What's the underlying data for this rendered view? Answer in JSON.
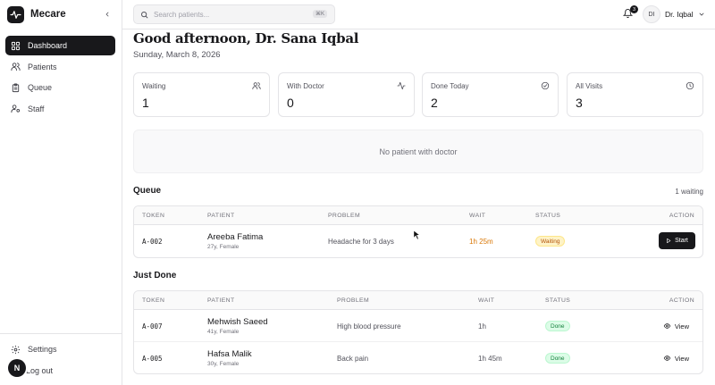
{
  "app": {
    "name": "Mecare"
  },
  "sidebar": {
    "items": [
      {
        "label": "Dashboard",
        "icon": "grid-icon",
        "active": true
      },
      {
        "label": "Patients",
        "icon": "users-icon"
      },
      {
        "label": "Queue",
        "icon": "clipboard-icon"
      },
      {
        "label": "Staff",
        "icon": "user-cog-icon"
      }
    ],
    "settings_label": "Settings",
    "logout_label": "Log out",
    "badge_letter": "N"
  },
  "topbar": {
    "search_placeholder": "Search patients...",
    "search_shortcut": "⌘K",
    "notification_count": "3",
    "user_initials": "DI",
    "user_name": "Dr. Iqbal"
  },
  "greeting": "Good afternoon, Dr. Sana Iqbal",
  "date": "Sunday, March 8, 2026",
  "stats": [
    {
      "label": "Waiting",
      "value": "1",
      "icon": "users-icon"
    },
    {
      "label": "With Doctor",
      "value": "0",
      "icon": "activity-icon"
    },
    {
      "label": "Done Today",
      "value": "2",
      "icon": "check-circle-icon"
    },
    {
      "label": "All Visits",
      "value": "3",
      "icon": "clock-icon"
    }
  ],
  "empty_with_doctor": "No patient with doctor",
  "queue": {
    "title": "Queue",
    "meta": "1 waiting",
    "columns": [
      "TOKEN",
      "PATIENT",
      "PROBLEM",
      "WAIT",
      "STATUS",
      "ACTION"
    ],
    "rows": [
      {
        "token": "A-002",
        "name": "Areeba Fatima",
        "meta": "27y, Female",
        "problem": "Headache for 3 days",
        "wait": "1h 25m",
        "status": "Waiting",
        "action": "Start"
      }
    ]
  },
  "just_done": {
    "title": "Just Done",
    "columns": [
      "TOKEN",
      "PATIENT",
      "PROBLEM",
      "WAIT",
      "STATUS",
      "ACTION"
    ],
    "rows": [
      {
        "token": "A-007",
        "name": "Mehwish Saeed",
        "meta": "41y, Female",
        "problem": "High blood pressure",
        "wait": "1h",
        "status": "Done",
        "action": "View"
      },
      {
        "token": "A-005",
        "name": "Hafsa Malik",
        "meta": "30y, Female",
        "problem": "Back pain",
        "wait": "1h 45m",
        "status": "Done",
        "action": "View"
      }
    ]
  },
  "colors": {
    "primary": "#18181b",
    "waiting": "#d97706",
    "done": "#15803d",
    "border": "#e4e4e7"
  }
}
